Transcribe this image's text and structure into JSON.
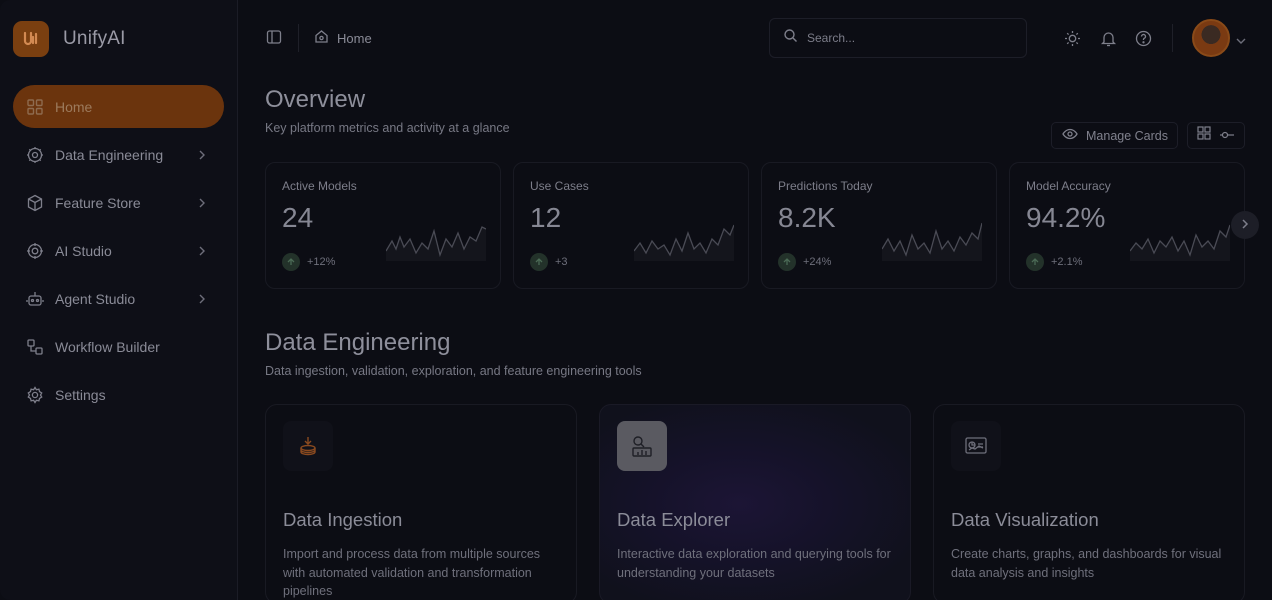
{
  "brand": {
    "name": "UnifyAI"
  },
  "sidebar": {
    "items": [
      {
        "label": "Home",
        "icon": "grid-icon",
        "active": true
      },
      {
        "label": "Data Engineering",
        "icon": "database-gear-icon",
        "has_children": true
      },
      {
        "label": "Feature Store",
        "icon": "cube-icon",
        "has_children": true
      },
      {
        "label": "AI Studio",
        "icon": "ai-chip-icon",
        "has_children": true
      },
      {
        "label": "Agent Studio",
        "icon": "robot-icon",
        "has_children": true
      },
      {
        "label": "Workflow Builder",
        "icon": "workflow-icon"
      },
      {
        "label": "Settings",
        "icon": "gear-icon"
      }
    ]
  },
  "topbar": {
    "breadcrumb": "Home",
    "search_placeholder": "Search..."
  },
  "overview": {
    "title": "Overview",
    "subtitle": "Key platform metrics and activity at a glance",
    "manage_label": "Manage Cards"
  },
  "metrics": [
    {
      "label": "Active Models",
      "value": "24",
      "trend": "+12%"
    },
    {
      "label": "Use Cases",
      "value": "12",
      "trend": "+3"
    },
    {
      "label": "Predictions Today",
      "value": "8.2K",
      "trend": "+24%"
    },
    {
      "label": "Model Accuracy",
      "value": "94.2%",
      "trend": "+2.1%"
    }
  ],
  "data_engineering": {
    "title": "Data Engineering",
    "subtitle": "Data ingestion, validation, exploration, and feature engineering tools",
    "tools": [
      {
        "title": "Data Ingestion",
        "description": "Import and process data from multiple sources with automated validation and transformation pipelines",
        "icon": "database-upload-icon"
      },
      {
        "title": "Data Explorer",
        "description": "Interactive data exploration and querying tools for understanding your datasets",
        "icon": "explorer-chart-icon"
      },
      {
        "title": "Data Visualization",
        "description": "Create charts, graphs, and dashboards for visual data analysis and insights",
        "icon": "dashboard-icon"
      }
    ]
  },
  "colors": {
    "accent": "#6b340d",
    "background": "#0c0d14",
    "trend_positive": "#23322a"
  }
}
